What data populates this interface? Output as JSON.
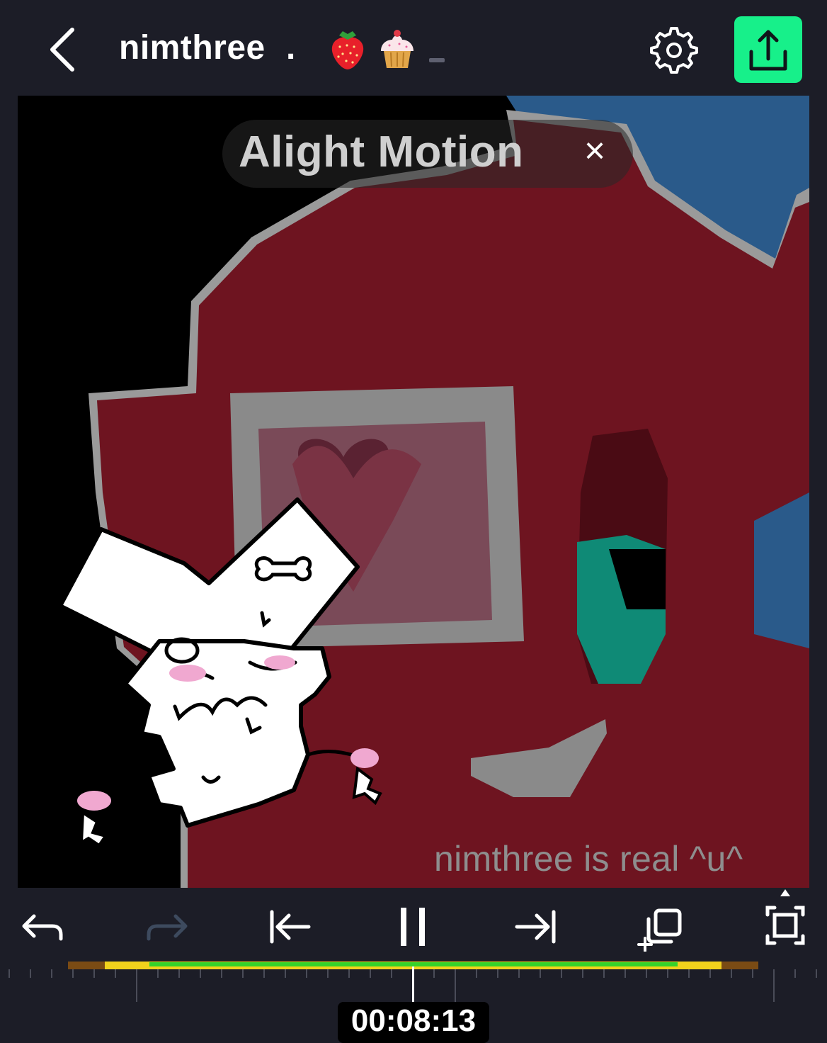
{
  "header": {
    "title": "nimthree",
    "dot": "."
  },
  "preview": {
    "watermark": "Alight Motion",
    "watermark_close": "×",
    "caption": "nimthree is real ^u^"
  },
  "timeline": {
    "timecode": "00:08:13"
  },
  "colors": {
    "accent": "#17f08a",
    "background": "#1c1d27",
    "track_yellow": "#f1d21c",
    "track_green": "#35d22a",
    "track_orange": "#7a4b14"
  },
  "icons": [
    "back-icon",
    "strawberry-emoji",
    "cupcake-emoji",
    "settings-icon",
    "export-icon",
    "undo-icon",
    "redo-icon",
    "skip-to-start-icon",
    "pause-icon",
    "skip-to-end-icon",
    "add-layer-icon",
    "fullscreen-icon"
  ]
}
